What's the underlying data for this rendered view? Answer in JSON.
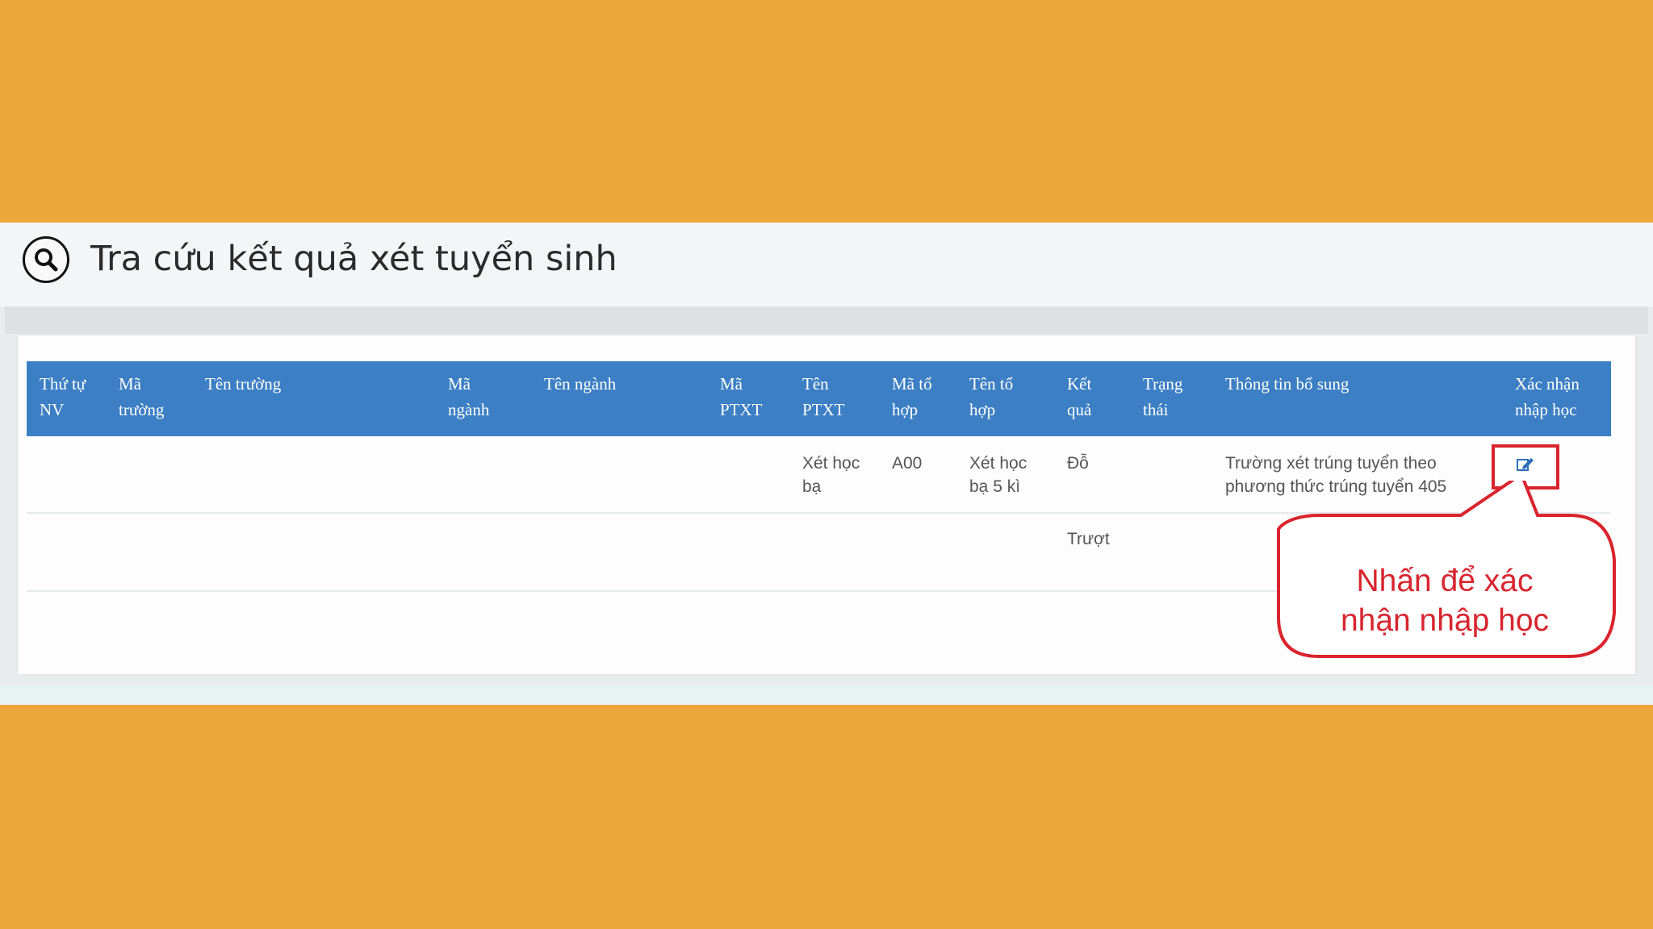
{
  "page": {
    "title": "Tra cứu kết quả xét tuyển sinh"
  },
  "table": {
    "headers": [
      [
        "Thứ tự",
        "NV"
      ],
      [
        "Mã",
        "trường"
      ],
      [
        "",
        "Tên trường"
      ],
      [
        "Mã",
        "ngành"
      ],
      [
        "",
        "Tên ngành"
      ],
      [
        "Mã",
        "PTXT"
      ],
      [
        "Tên",
        "PTXT"
      ],
      [
        "Mã tổ",
        "hợp"
      ],
      [
        "Tên tổ",
        "hợp"
      ],
      [
        "Kết",
        "quả"
      ],
      [
        "Trạng",
        "thái"
      ],
      [
        "",
        "Thông tin bổ sung"
      ],
      [
        "Xác nhận",
        "nhập học"
      ]
    ],
    "rows": [
      {
        "ten_ptxt": [
          "Xét học",
          "bạ"
        ],
        "ma_to_hop": "A00",
        "ten_to_hop": [
          "Xét học",
          "bạ 5 kì"
        ],
        "ket_qua": "Đỗ",
        "thong_tin": [
          "Trường xét trúng tuyển theo",
          "phương thức trúng tuyển 405"
        ]
      },
      {
        "ket_qua": "Trượt"
      }
    ]
  },
  "callout": {
    "line1": "Nhấn để xác",
    "line2": "nhận nhập học"
  },
  "colors": {
    "background": "#eea73b",
    "header": "#3c7fc4",
    "highlight": "#d9242e",
    "edit_icon": "#2f6fba"
  },
  "icons": {
    "search": "search-icon",
    "edit": "edit-icon"
  }
}
